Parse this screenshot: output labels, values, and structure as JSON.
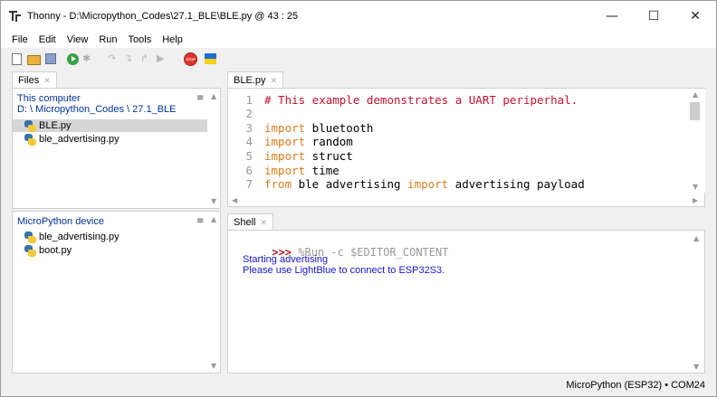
{
  "window": {
    "title": "Thonny  -  D:\\Micropython_Codes\\27.1_BLE\\BLE.py  @  43 : 25",
    "minimize": "—",
    "maximize": "☐",
    "close": "✕"
  },
  "menu": [
    "File",
    "Edit",
    "View",
    "Run",
    "Tools",
    "Help"
  ],
  "toolbar": {
    "icons": [
      "new-file-icon",
      "open-file-icon",
      "save-icon",
      "run-icon",
      "debug-icon",
      "step-over-icon",
      "step-into-icon",
      "step-out-icon",
      "resume-icon",
      "stop-icon",
      "ukraine-flag-icon"
    ],
    "stop_label": "STOP"
  },
  "files_panel": {
    "tab": "Files",
    "computer": {
      "title": "This computer",
      "path": "D: \\ Micropython_Codes \\ 27.1_BLE",
      "files": [
        "BLE.py",
        "ble_advertising.py"
      ],
      "selected": "BLE.py"
    },
    "device": {
      "title": "MicroPython device",
      "files": [
        "ble_advertising.py",
        "boot.py"
      ]
    }
  },
  "editor": {
    "tab": "BLE.py",
    "lines": [
      {
        "n": "1",
        "parts": [
          {
            "t": "# This example demonstrates a UART periperhal.",
            "c": "cm"
          }
        ]
      },
      {
        "n": "2",
        "parts": []
      },
      {
        "n": "3",
        "parts": [
          {
            "t": "import",
            "c": "kw"
          },
          {
            "t": " bluetooth",
            "c": "txt"
          }
        ]
      },
      {
        "n": "4",
        "parts": [
          {
            "t": "import",
            "c": "kw"
          },
          {
            "t": " random",
            "c": "txt"
          }
        ]
      },
      {
        "n": "5",
        "parts": [
          {
            "t": "import",
            "c": "kw"
          },
          {
            "t": " struct",
            "c": "txt"
          }
        ]
      },
      {
        "n": "6",
        "parts": [
          {
            "t": "import",
            "c": "kw"
          },
          {
            "t": " time",
            "c": "txt"
          }
        ]
      },
      {
        "n": "7",
        "parts": [
          {
            "t": "from",
            "c": "kw"
          },
          {
            "t": " ble advertising ",
            "c": "txt"
          },
          {
            "t": "import",
            "c": "kw"
          },
          {
            "t": " advertising payload",
            "c": "txt"
          }
        ]
      }
    ]
  },
  "shell": {
    "tab": "Shell",
    "prompt": ">>>",
    "command": " %Run -c $EDITOR_CONTENT",
    "output": [
      "Starting advertising",
      "Please use LightBlue to connect to ESP32S3."
    ]
  },
  "status": {
    "text": "MicroPython (ESP32)  •  COM24"
  }
}
